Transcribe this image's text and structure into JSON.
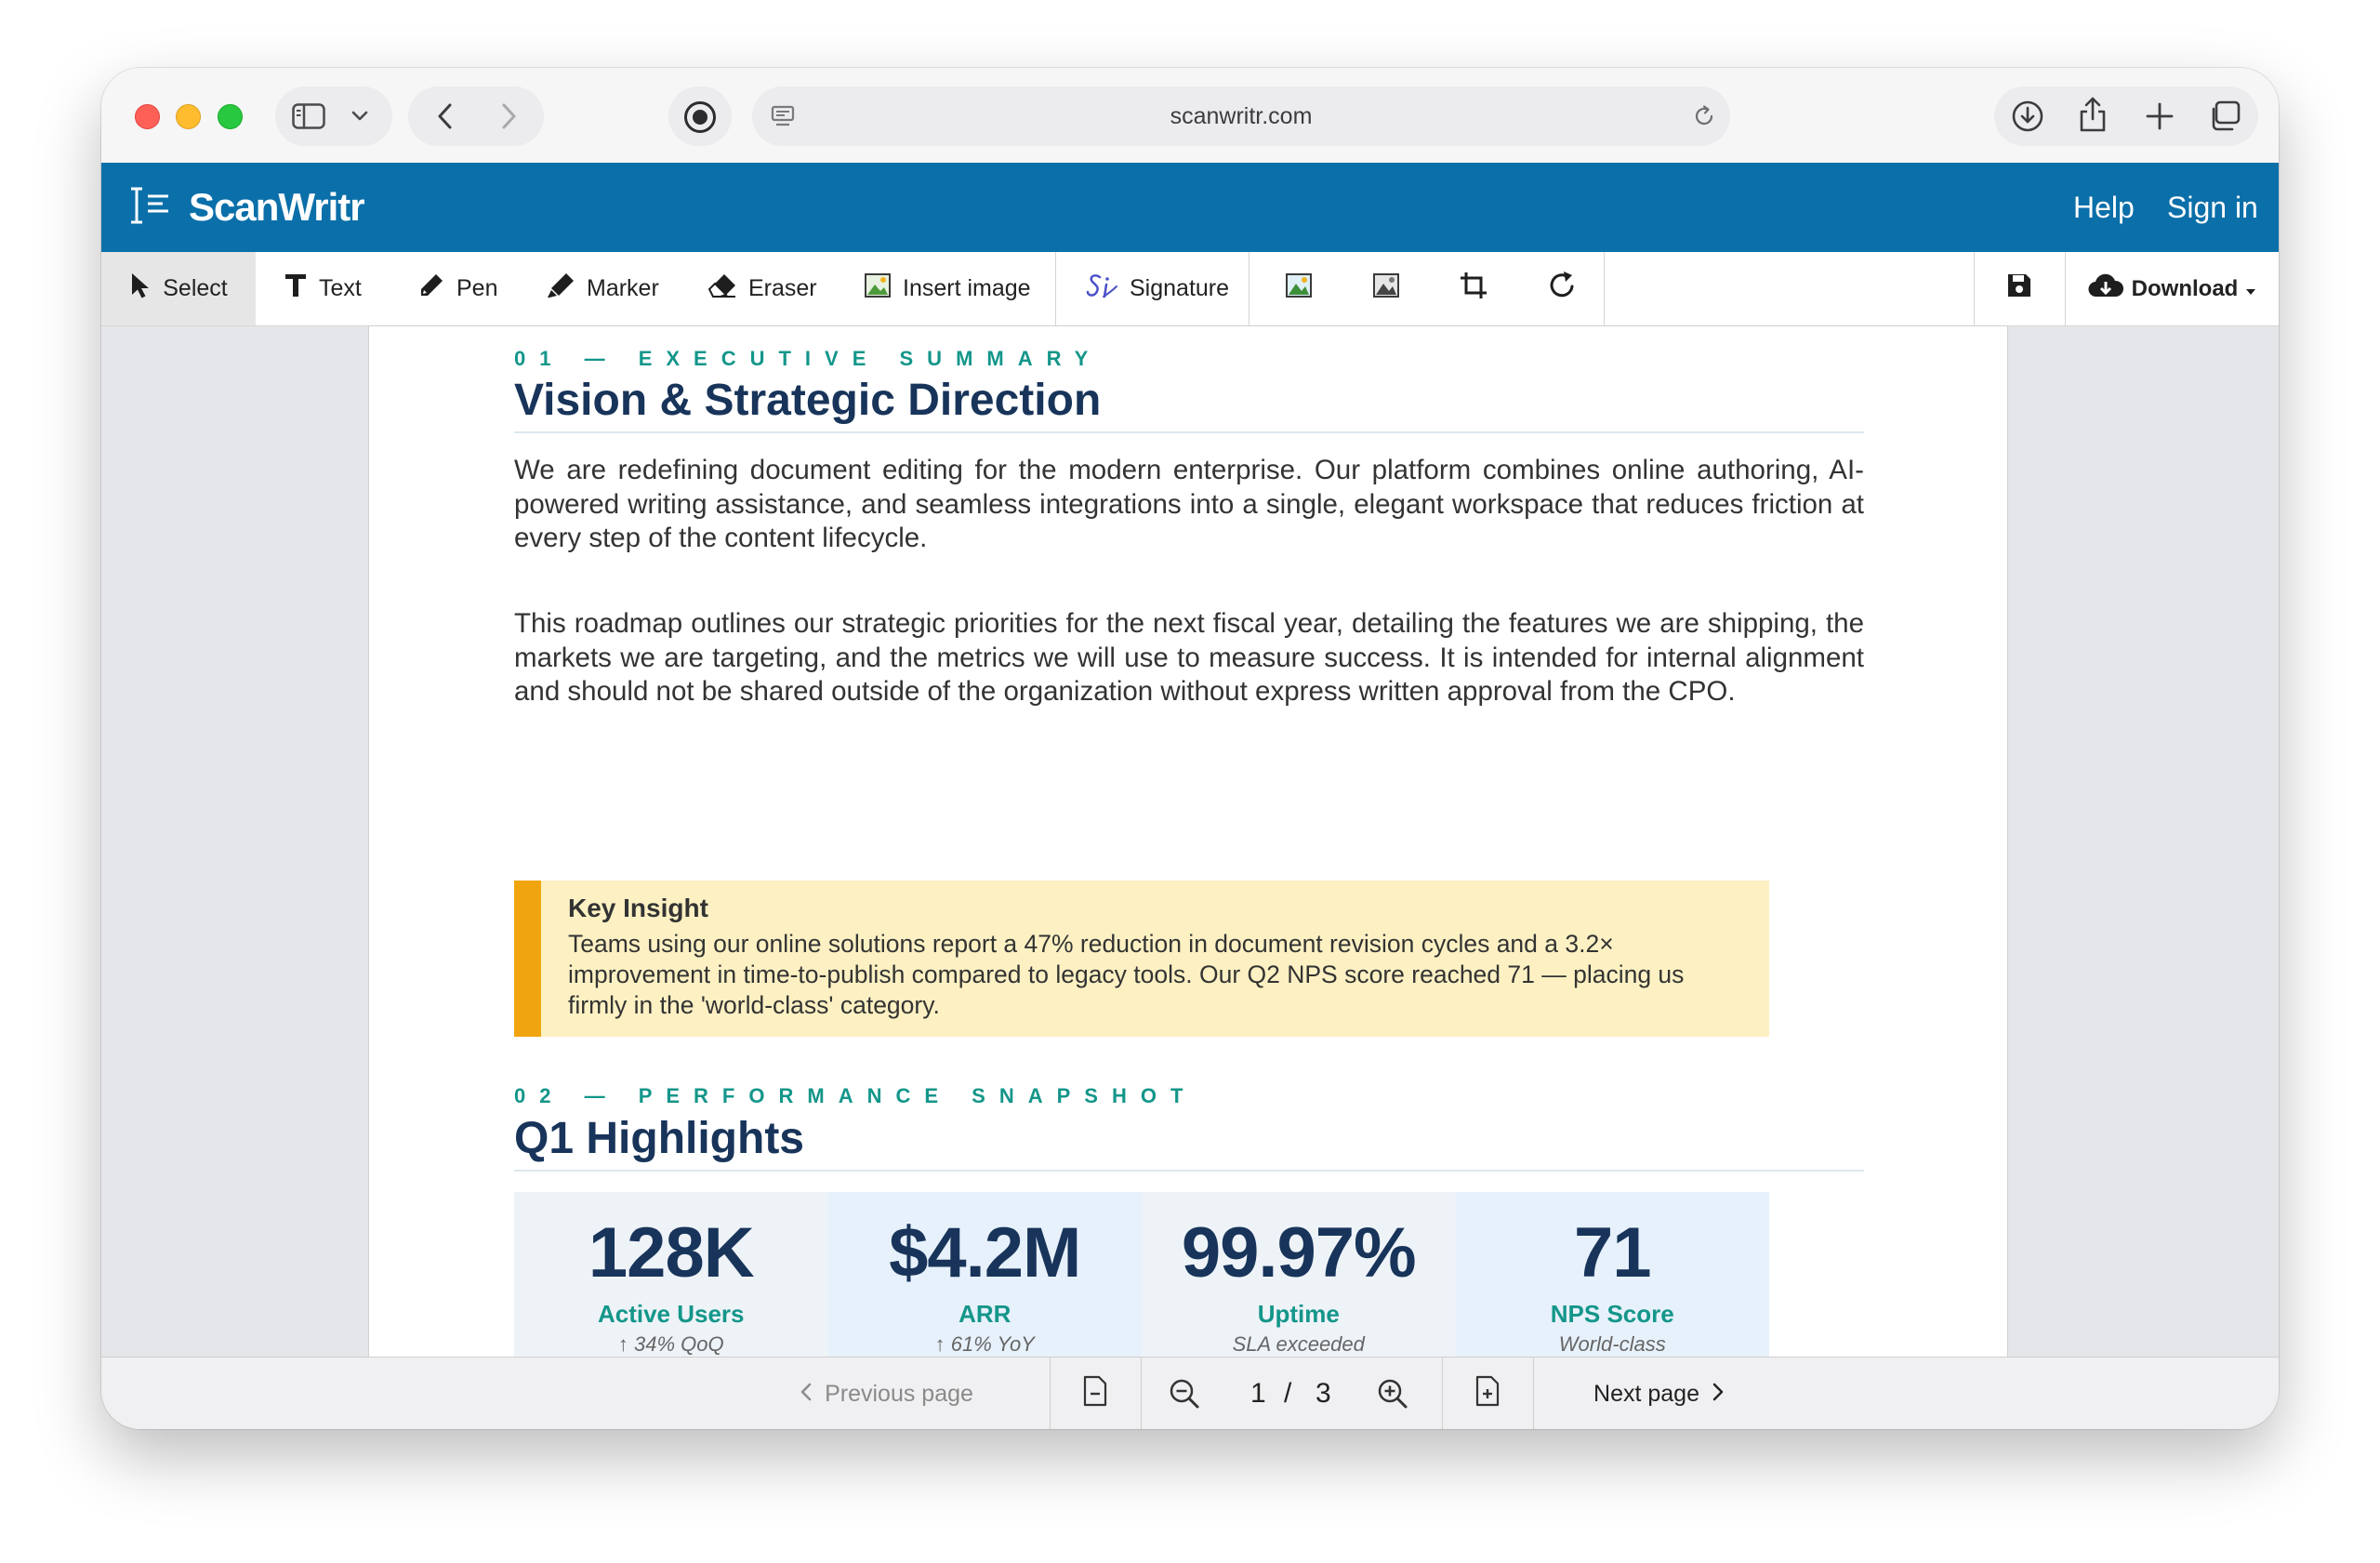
{
  "browser": {
    "url": "scanwritr.com"
  },
  "app": {
    "name": "ScanWritr",
    "nav": {
      "help": "Help",
      "sign_in": "Sign in"
    }
  },
  "toolbar": {
    "select": "Select",
    "text": "Text",
    "pen": "Pen",
    "marker": "Marker",
    "eraser": "Eraser",
    "insert_image": "Insert image",
    "signature": "Signature",
    "download": "Download"
  },
  "document": {
    "section1": {
      "kicker": "01 — EXECUTIVE SUMMARY",
      "title": "Vision & Strategic Direction",
      "p1": "We are redefining document editing for the modern enterprise. Our platform combines online authoring, AI-powered writing assistance, and seamless integrations into a single, elegant workspace that reduces friction at every step of the content lifecycle.",
      "p2": "This roadmap outlines our strategic priorities for the next fiscal year, detailing the features we are shipping, the markets we are targeting, and the metrics we will use to measure success. It is intended for internal alignment and should not be shared outside of the organization without express written approval from the CPO."
    },
    "callout": {
      "title": "Key Insight",
      "body": "Teams using our online solutions report a 47% reduction in document revision cycles and a 3.2× improvement in time-to-publish compared to legacy tools. Our Q2 NPS score reached 71 — placing us firmly in the 'world-class' category."
    },
    "section2": {
      "kicker": "02 — PERFORMANCE SNAPSHOT",
      "title": "Q1 Highlights"
    },
    "stats": [
      {
        "value": "128K",
        "label": "Active Users",
        "sub": "↑ 34% QoQ"
      },
      {
        "value": "$4.2M",
        "label": "ARR",
        "sub": "↑ 61% YoY"
      },
      {
        "value": "99.97%",
        "label": "Uptime",
        "sub": "SLA exceeded"
      },
      {
        "value": "71",
        "label": "NPS Score",
        "sub": "World-class"
      }
    ]
  },
  "pager": {
    "previous": "Previous page",
    "current": "1",
    "separator": "/",
    "total": "3",
    "next": "Next page"
  },
  "colors": {
    "brand_blue": "#0b6fa9",
    "teal": "#14968a",
    "navy": "#18345a",
    "callout_bg": "#fdf1c3",
    "callout_accent": "#f0a510"
  }
}
